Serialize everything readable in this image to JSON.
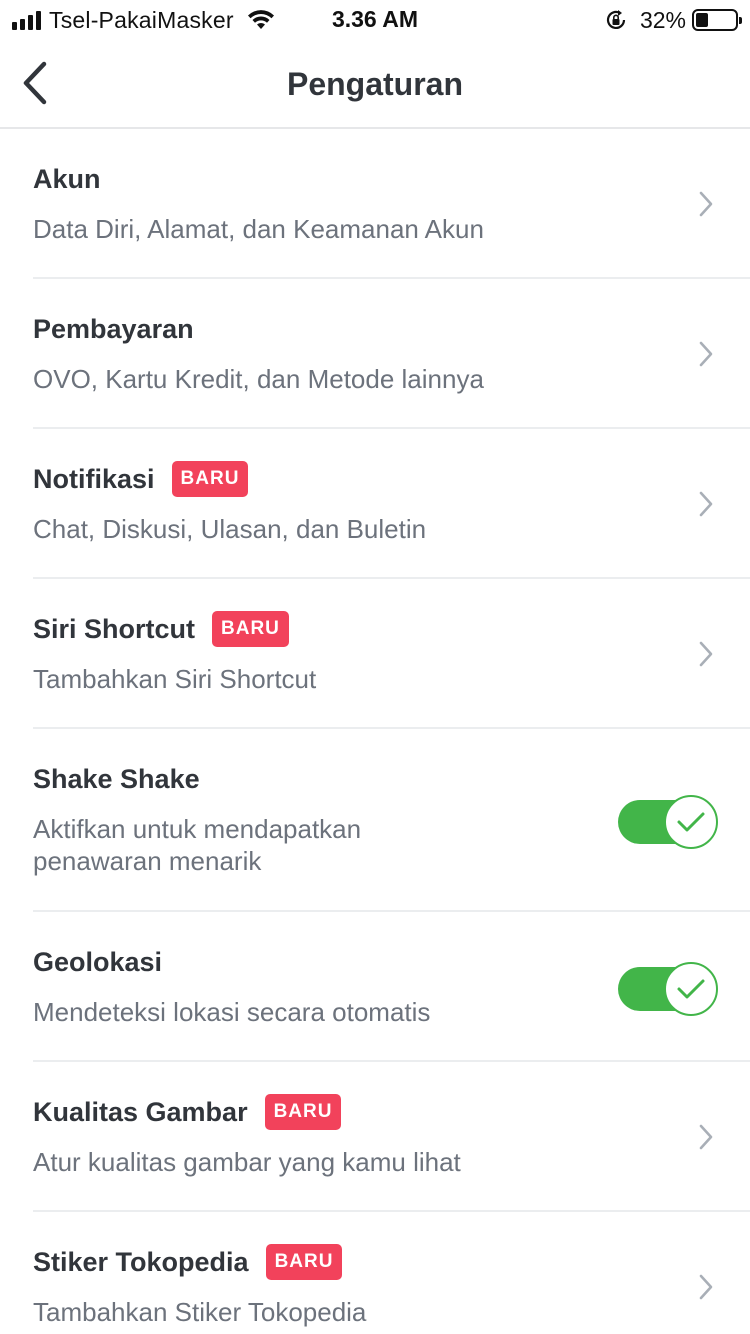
{
  "status_bar": {
    "carrier": "Tsel-PakaiMasker",
    "time": "3.36 AM",
    "battery": "32%",
    "battery_level": 0.32
  },
  "header": {
    "title": "Pengaturan",
    "back_icon": "chevron-left-icon"
  },
  "colors": {
    "accent_green": "#42b549",
    "badge_red": "#f2425b",
    "title_text": "#31353b",
    "subtitle_text": "#6c727c"
  },
  "settings": [
    {
      "title": "Akun",
      "subtitle": "Data Diri, Alamat, dan Keamanan Akun",
      "badge": "",
      "control": "chevron"
    },
    {
      "title": "Pembayaran",
      "subtitle": "OVO, Kartu Kredit, dan Metode lainnya",
      "badge": "",
      "control": "chevron"
    },
    {
      "title": "Notifikasi",
      "subtitle": "Chat, Diskusi, Ulasan, dan Buletin",
      "badge": "BARU",
      "control": "chevron"
    },
    {
      "title": "Siri Shortcut",
      "subtitle": "Tambahkan Siri Shortcut",
      "badge": "BARU",
      "control": "chevron"
    },
    {
      "title": "Shake Shake",
      "subtitle": "Aktifkan untuk mendapatkan penawaran menarik",
      "badge": "",
      "control": "toggle",
      "enabled": true
    },
    {
      "title": "Geolokasi",
      "subtitle": "Mendeteksi lokasi secara otomatis",
      "badge": "",
      "control": "toggle",
      "enabled": true
    },
    {
      "title": "Kualitas Gambar",
      "subtitle": "Atur kualitas gambar yang kamu lihat",
      "badge": "BARU",
      "control": "chevron"
    },
    {
      "title": "Stiker Tokopedia",
      "subtitle": "Tambahkan Stiker Tokopedia",
      "badge": "BARU",
      "control": "chevron"
    }
  ]
}
